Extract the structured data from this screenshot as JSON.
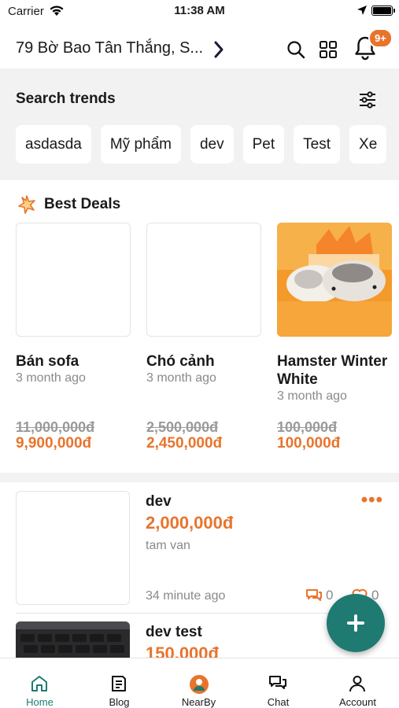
{
  "status_bar": {
    "carrier": "Carrier",
    "time": "11:38 AM"
  },
  "header": {
    "address": "79 Bờ Bao Tân Thắng, S...",
    "notification_count": "9+"
  },
  "search_trends": {
    "title": "Search trends",
    "chips": [
      "asdasda",
      "Mỹ phẩm",
      "dev",
      "Pet",
      "Test",
      "Xe"
    ]
  },
  "best_deals": {
    "title": "Best Deals",
    "items": [
      {
        "title": "Bán sofa",
        "time": "3 month ago",
        "old_price": "11,000,000đ",
        "price": "9,900,000đ",
        "has_image": false
      },
      {
        "title": "Chó cảnh",
        "time": "3 month ago",
        "old_price": "2,500,000đ",
        "price": "2,450,000đ",
        "has_image": false
      },
      {
        "title": "Hamster Winter White",
        "time": "3 month ago",
        "old_price": "100,000đ",
        "price": "100,000đ",
        "has_image": true
      }
    ]
  },
  "listings": [
    {
      "title": "dev",
      "price": "2,000,000đ",
      "seller": "tam van",
      "time": "34 minute ago",
      "comments": "0",
      "likes": "0"
    },
    {
      "title": "dev test",
      "price": "150,000đ"
    }
  ],
  "bottom_nav": {
    "items": [
      {
        "label": "Home",
        "icon": "home-icon",
        "active": true
      },
      {
        "label": "Blog",
        "icon": "blog-icon",
        "active": false
      },
      {
        "label": "NearBy",
        "icon": "nearby-icon",
        "active": false
      },
      {
        "label": "Chat",
        "icon": "chat-icon",
        "active": false
      },
      {
        "label": "Account",
        "icon": "account-icon",
        "active": false
      }
    ]
  },
  "colors": {
    "accent": "#e8742c",
    "primary": "#1f7a72",
    "muted": "#8a8a8a",
    "section_bg": "#f2f2f2"
  }
}
